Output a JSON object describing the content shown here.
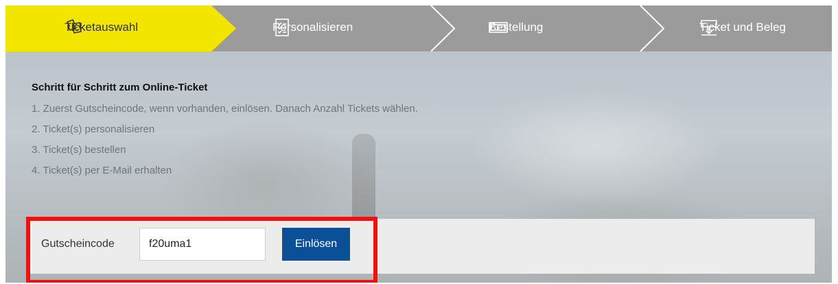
{
  "stepper": {
    "steps": [
      {
        "label": "Ticketauswahl",
        "icon": "tickets-icon",
        "active": true
      },
      {
        "label": "Personalisieren",
        "icon": "checklist-icon",
        "active": false
      },
      {
        "label": "Bestellung",
        "icon": "money-icon",
        "active": false
      },
      {
        "label": "Ticket und Beleg",
        "icon": "ticket-download-icon",
        "active": false
      }
    ],
    "active_color": "#f2e600",
    "inactive_color": "#9b9b9b"
  },
  "info": {
    "title": "Schritt für Schritt zum Online-Ticket",
    "items": [
      "1. Zuerst Gutscheincode, wenn vorhanden, einlösen. Danach Anzahl Tickets wählen.",
      "2. Ticket(s) personalisieren",
      "3. Ticket(s) bestellen",
      "4. Ticket(s) per E-Mail erhalten"
    ]
  },
  "voucher": {
    "label": "Gutscheincode",
    "input_value": "f20uma1",
    "button_label": "Einlösen",
    "button_color": "#0b4f96",
    "highlight_color": "#ee1111"
  }
}
